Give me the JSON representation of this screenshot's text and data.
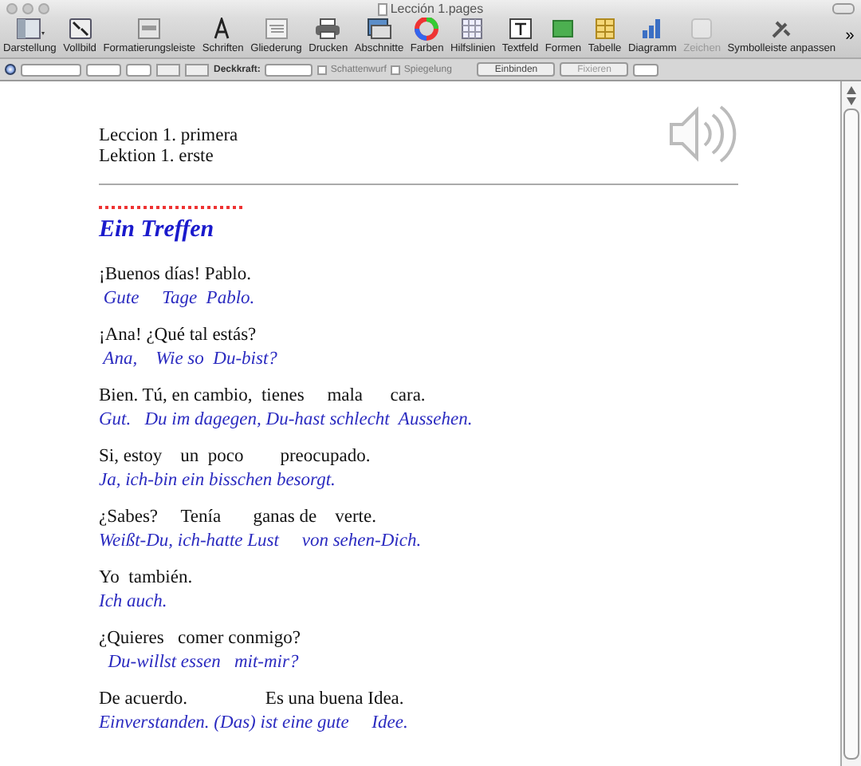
{
  "window": {
    "title": "Lección 1.pages"
  },
  "toolbar": {
    "items": [
      {
        "label": "Darstellung",
        "disabled": false
      },
      {
        "label": "Vollbild",
        "disabled": false
      },
      {
        "label": "Formatierungsleiste",
        "disabled": false
      },
      {
        "label": "Schriften",
        "disabled": false
      },
      {
        "label": "Gliederung",
        "disabled": false
      },
      {
        "label": "Drucken",
        "disabled": false
      },
      {
        "label": "Abschnitte",
        "disabled": false
      },
      {
        "label": "Farben",
        "disabled": false
      },
      {
        "label": "Hilfslinien",
        "disabled": false
      },
      {
        "label": "Textfeld",
        "disabled": false
      },
      {
        "label": "Formen",
        "disabled": false
      },
      {
        "label": "Tabelle",
        "disabled": false
      },
      {
        "label": "Diagramm",
        "disabled": false
      },
      {
        "label": "Zeichen",
        "disabled": true
      },
      {
        "label": "Symbolleiste anpassen",
        "disabled": false
      }
    ],
    "overflow": "»"
  },
  "format_bar": {
    "opacity_label": "Deckkraft:",
    "checkboxes": [
      {
        "label": "Schattenwurf",
        "checked": false
      },
      {
        "label": "Spiegelung",
        "checked": false
      }
    ],
    "buttons": [
      {
        "label": "Einbinden",
        "disabled": false
      },
      {
        "label": "Fixieren",
        "disabled": true
      }
    ]
  },
  "document": {
    "header": [
      "Leccion 1. primera",
      "Lektion 1. erste"
    ],
    "heading": "Ein Treffen",
    "pairs": [
      {
        "spanish": "¡Buenos días! Pablo.",
        "german": " Gute     Tage  Pablo."
      },
      {
        "spanish": "¡Ana! ¿Qué tal estás?",
        "german": " Ana,    Wie so  Du-bist?"
      },
      {
        "spanish": "Bien. Tú, en cambio,  tienes     mala      cara.",
        "german": "Gut.   Du im dagegen, Du-hast schlecht  Aussehen."
      },
      {
        "spanish": "Si, estoy    un  poco        preocupado.",
        "german": "Ja, ich-bin ein bisschen besorgt."
      },
      {
        "spanish": "¿Sabes?     Tenía       ganas de    verte.",
        "german": "Weißt-Du, ich-hatte Lust     von sehen-Dich."
      },
      {
        "spanish": "Yo  también.",
        "german": "Ich auch."
      },
      {
        "spanish": "¿Quieres   comer conmigo?",
        "german": "  Du-willst essen   mit-mir?"
      },
      {
        "spanish": "De acuerdo.                 Es una buena Idea.",
        "german": "Einverstanden. (Das) ist eine gute     Idee."
      }
    ]
  }
}
